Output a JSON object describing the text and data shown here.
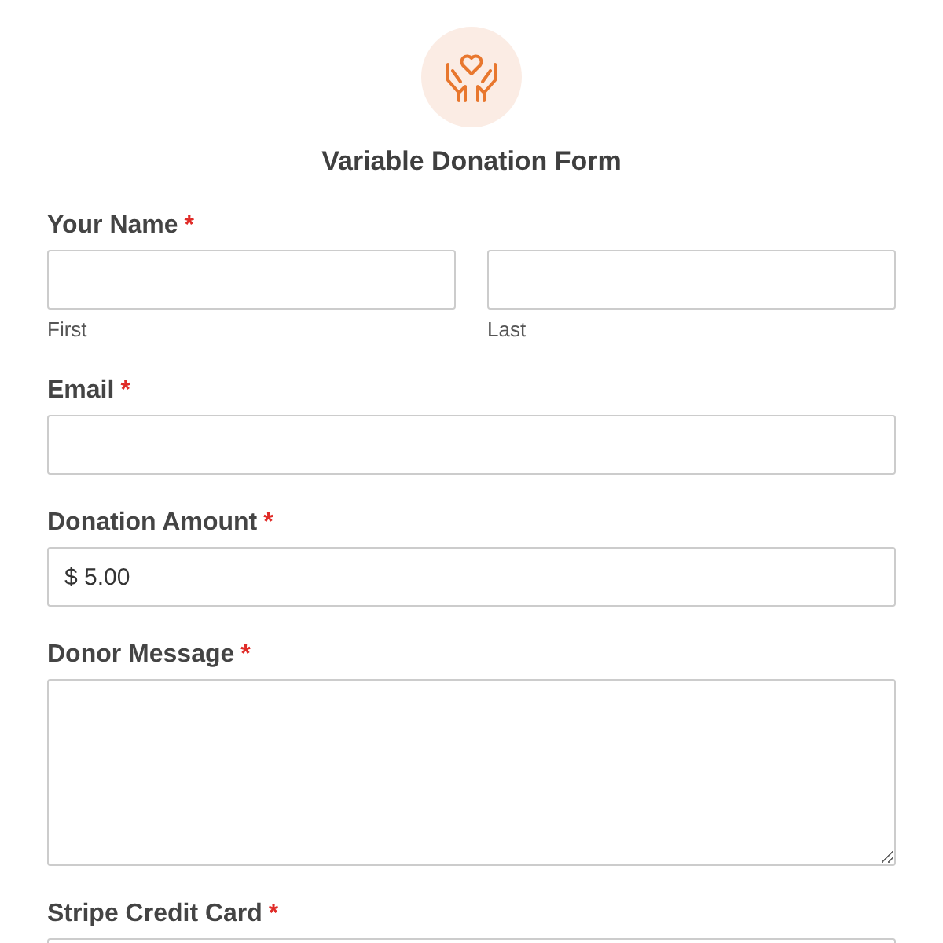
{
  "form": {
    "title": "Variable Donation Form"
  },
  "fields": [
    {
      "kind": "name",
      "label": "Your Name",
      "required_mark": "*",
      "parts": [
        {
          "sublabel": "First"
        },
        {
          "sublabel": "Last"
        }
      ]
    },
    {
      "kind": "text",
      "label": "Email",
      "required_mark": "*"
    },
    {
      "kind": "text",
      "label": "Donation Amount",
      "required_mark": "*",
      "value": "$ 5.00"
    },
    {
      "kind": "textarea",
      "label": "Donor Message",
      "required_mark": "*"
    },
    {
      "kind": "card",
      "label": "Stripe Credit Card",
      "required_mark": "*"
    }
  ]
}
